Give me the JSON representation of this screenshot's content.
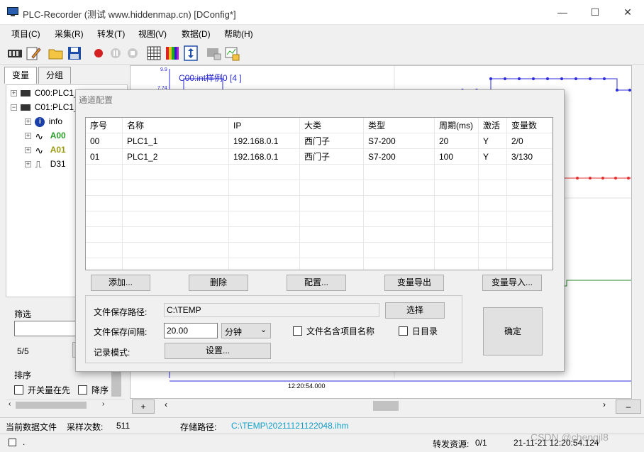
{
  "window": {
    "title": "PLC-Recorder (测试 www.hiddenmap.cn) [DConfig*]",
    "minimize": "—",
    "maximize": "☐",
    "close": "✕"
  },
  "menu": [
    "项目(C)",
    "采集(R)",
    "转发(T)",
    "视图(V)",
    "数据(D)",
    "帮助(H)"
  ],
  "toolbar_icons": [
    "plc-icon",
    "edit-icon",
    "open-folder-icon",
    "save-icon",
    "record-icon",
    "pause-icon",
    "stop-icon",
    "grid-icon",
    "color-palette-icon",
    "fit-vertical-icon",
    "plc-gray-icon",
    "chart-export-icon"
  ],
  "sidebar": {
    "tabs": [
      "变量",
      "分组"
    ],
    "tree": [
      {
        "label": "C00:PLC1_1",
        "type": "plc"
      },
      {
        "label": "C01:PLC1_2",
        "type": "plc"
      },
      {
        "label": "info",
        "type": "info"
      },
      {
        "label": "A00",
        "type": "analog-green"
      },
      {
        "label": "A01",
        "type": "analog-olive"
      },
      {
        "label": "D31",
        "type": "digital"
      }
    ],
    "filter_label": "筛选",
    "filter_value": "",
    "count": "5/5",
    "sort_label": "排序",
    "switch_first": "开关量在先",
    "descending": "降序"
  },
  "chart": {
    "y_top": "9.9",
    "y_second": "7.74",
    "series_label": "C00:int样例0 [4 ]",
    "x_tick": "12:20:54.000",
    "add_button": "+",
    "minus_button": "–"
  },
  "dialog": {
    "title": "通道配置",
    "columns": [
      "序号",
      "名称",
      "IP",
      "大类",
      "类型",
      "周期(ms)",
      "激活",
      "变量数"
    ],
    "rows": [
      [
        "00",
        "PLC1_1",
        "192.168.0.1",
        "西门子",
        "S7-200",
        "20",
        "Y",
        "2/0"
      ],
      [
        "01",
        "PLC1_2",
        "192.168.0.1",
        "西门子",
        "S7-200",
        "100",
        "Y",
        "3/130"
      ]
    ],
    "buttons": {
      "add": "添加...",
      "delete": "删除",
      "config": "配置...",
      "export_vars": "变量导出",
      "import_vars": "变量导入...",
      "ok": "确定",
      "choose": "选择",
      "settings": "设置..."
    },
    "save_path_label": "文件保存路径:",
    "save_path_value": "C:\\TEMP",
    "interval_label": "文件保存间隔:",
    "interval_value": "20.00",
    "interval_unit": "分钟",
    "file_name_project": "文件名含项目名称",
    "daily_dir": "日目录",
    "record_mode_label": "记录模式:"
  },
  "status": {
    "current_file": "当前数据文件",
    "sample_count_label": "采样次数:",
    "sample_count": "511",
    "storage_label": "存储路径:",
    "storage_path": "C:\\TEMP\\20211121122048.ihm",
    "dot": ".",
    "forward_label": "转发资源:",
    "forward_value": "0/1",
    "datetime": "21-11-21 12:20:54.124",
    "watermark": "CSDN @chengjl8"
  },
  "colors": {
    "blue_series": "#2b2bd8",
    "red_series": "#e03030",
    "green_series": "#2a8a2a",
    "storage_path": "#12a0c8"
  }
}
